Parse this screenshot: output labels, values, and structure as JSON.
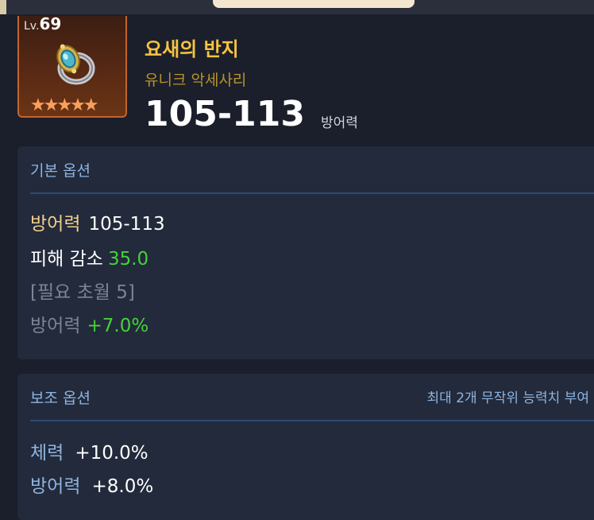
{
  "item": {
    "level_prefix": "Lv.",
    "level": "69",
    "name": "요새의 반지",
    "type": "유니크 악세사리",
    "value": "105-113",
    "value_unit": "방어력",
    "stars": "★★★★★",
    "star_count": 5
  },
  "basic_options": {
    "title": "기본 옵션",
    "lines": [
      {
        "label": "방어력",
        "value": "105-113"
      },
      {
        "label": "피해 감소",
        "value": "35.0"
      },
      {
        "label": "[필요 초월 5]",
        "value": ""
      },
      {
        "label": "방어력",
        "value": "+7.0%"
      }
    ]
  },
  "sub_options": {
    "title": "보조 옵션",
    "note": "최대 2개 무작위 능력치 부여",
    "lines": [
      {
        "label": "체력",
        "value": "+10.0%"
      },
      {
        "label": "방어력",
        "value": "+8.0%"
      }
    ]
  },
  "colors": {
    "item_name": "#f6c441",
    "item_type": "#b8932d",
    "positive_value": "#47d13c",
    "section_title": "#8fb4e0",
    "frame_border": "#c4642a"
  },
  "icons": {
    "item": "ring-icon",
    "rarity": "star-icon"
  }
}
